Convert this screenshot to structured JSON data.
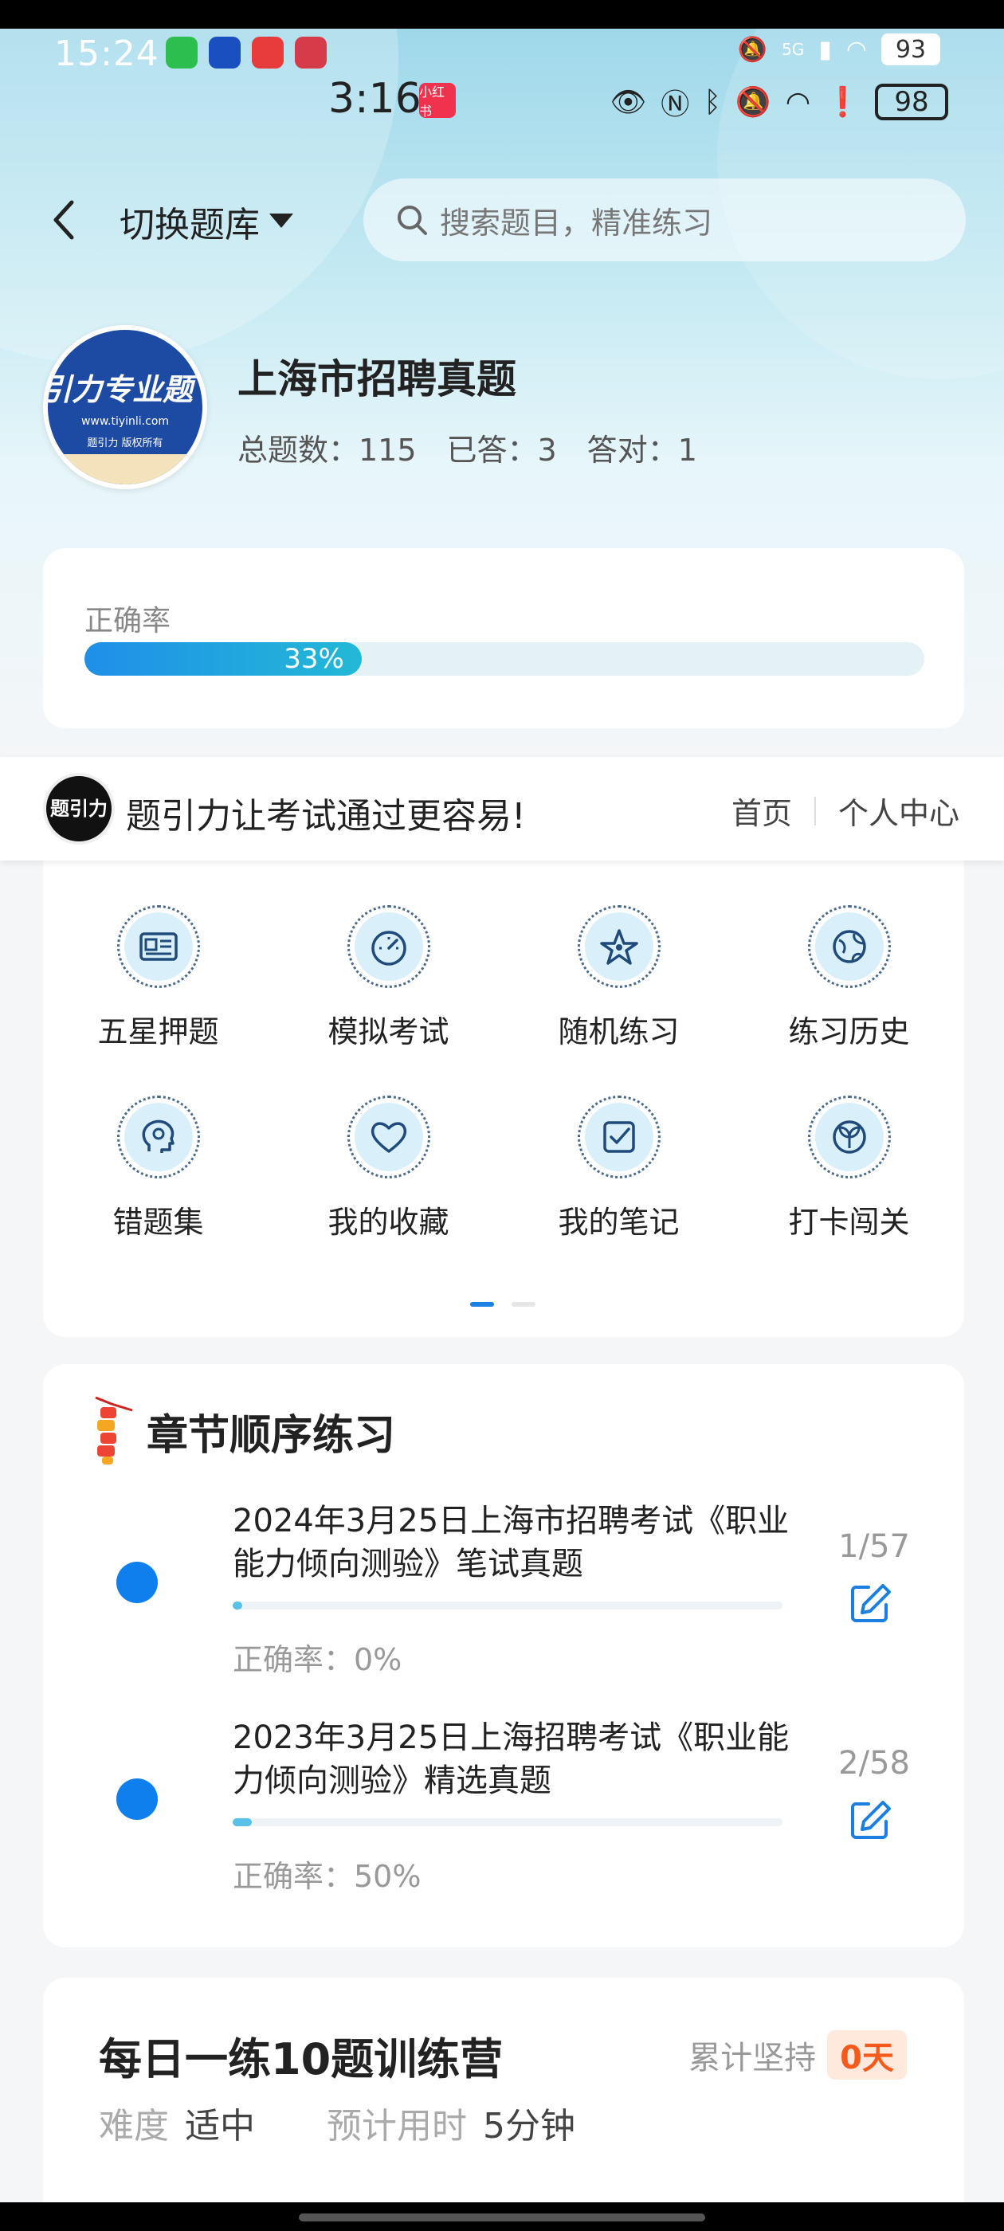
{
  "status_outer": {
    "time": "15:24",
    "battery": "93",
    "network": "5G"
  },
  "status_inner": {
    "time": "3:16",
    "badge": "小红书",
    "battery": "98"
  },
  "header": {
    "switch_label": "切换题库",
    "search_placeholder": "搜索题目，精准练习"
  },
  "bank": {
    "logo_text": "引力专业题",
    "logo_url": "www.tiyinli.com",
    "logo_copyright": "题引力 版权所有",
    "title": "上海市招聘真题",
    "stats": {
      "total": "总题数：115",
      "answered": "已答：3",
      "correct": "答对：1"
    }
  },
  "accuracy": {
    "label": "正确率",
    "percent_text": "33%",
    "value": 0.33
  },
  "banner": {
    "logo_text": "题引力",
    "slogan": "题引力让考试通过更容易!",
    "nav": [
      "首页",
      "个人中心"
    ]
  },
  "functions": [
    {
      "label": "五星押题",
      "icon": "id-card-icon"
    },
    {
      "label": "模拟考试",
      "icon": "gauge-icon"
    },
    {
      "label": "随机练习",
      "icon": "shuffle-star-icon"
    },
    {
      "label": "练习历史",
      "icon": "globe-icon"
    },
    {
      "label": "错题集",
      "icon": "head-icon"
    },
    {
      "label": "我的收藏",
      "icon": "heart-icon"
    },
    {
      "label": "我的笔记",
      "icon": "checkbox-icon"
    },
    {
      "label": "打卡闯关",
      "icon": "sprout-icon"
    }
  ],
  "chapters": {
    "title": "章节顺序练习",
    "items": [
      {
        "title": "2024年3月25日上海市招聘考试《职业能力倾向测验》笔试真题",
        "accuracy": "正确率：0%",
        "count": "1/57",
        "progress": 0.0175
      },
      {
        "title": "2023年3月25日上海招聘考试《职业能力倾向测验》精选真题",
        "accuracy": "正确率：50%",
        "count": "2/58",
        "progress": 0.0345
      }
    ]
  },
  "daily": {
    "title": "每日一练10题训练营",
    "streak_label": "累计坚持",
    "streak_value": "0天",
    "difficulty_label": "难度",
    "difficulty_value": "适中",
    "time_label": "预计用时",
    "time_value": "5分钟"
  },
  "colors": {
    "accent": "#0f7fee",
    "streak": "#f45a1c"
  }
}
